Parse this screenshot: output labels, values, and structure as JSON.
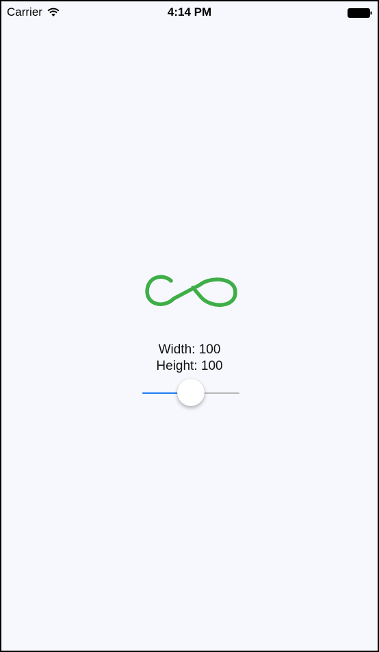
{
  "status_bar": {
    "carrier": "Carrier",
    "time": "4:14 PM",
    "wifi_icon": "wifi-icon",
    "battery_icon": "battery-icon"
  },
  "logo": {
    "icon": "infinity-logo-icon",
    "color": "#3fae48"
  },
  "labels": {
    "width": "Width: 100",
    "height": "Height: 100"
  },
  "slider": {
    "value_fraction": 0.5,
    "min_track_color": "#1a7cf5",
    "max_track_color": "#b7b7b7"
  },
  "colors": {
    "background": "#f7f8fd"
  }
}
